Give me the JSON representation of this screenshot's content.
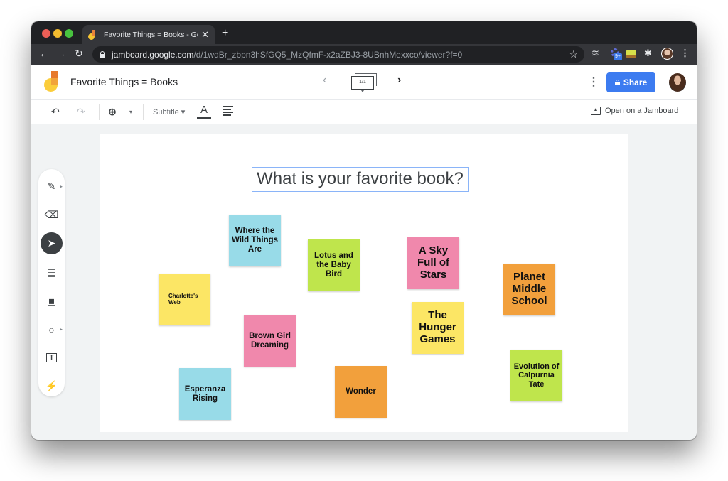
{
  "browser": {
    "tab": {
      "title": "Favorite Things = Books - Google Jamboard",
      "favicon": "jamboard-icon"
    },
    "new_tab": "+",
    "nav": {
      "back": "←",
      "forward": "→",
      "reload": "↻"
    },
    "url": {
      "host": "jamboard.google.com",
      "path": "/d/1wdBr_zbpn3hSfGQ5_MzQfmF-x2aZBJ3-8UBnhMexxco/viewer?f=0"
    },
    "star": "☆",
    "extensions": [
      {
        "name": "layers-extension",
        "glyph": "≋"
      },
      {
        "name": "gear-extension",
        "badge": "9+"
      },
      {
        "name": "note-extension"
      },
      {
        "name": "puzzle-extension",
        "glyph": "✦"
      },
      {
        "name": "profile-avatar"
      }
    ],
    "menu": "⋮"
  },
  "header": {
    "title": "Favorite Things = Books",
    "frame_prev": "‹",
    "frame_indicator": "1/1",
    "frame_next": "›",
    "more": "⋮",
    "share_label": "Share"
  },
  "edit_toolbar": {
    "undo": "↶",
    "redo": "↷",
    "zoom": "⊕",
    "zoom_caret": "▾",
    "text_style": "Subtitle ▾",
    "text_color": "A",
    "open_on_jamboard": "Open on a Jamboard"
  },
  "side_tools": [
    {
      "name": "pen-tool",
      "glyph": "✎",
      "has_menu": true
    },
    {
      "name": "eraser-tool",
      "glyph": "⌫"
    },
    {
      "name": "select-tool",
      "glyph": "➤",
      "active": true
    },
    {
      "name": "sticky-note-tool",
      "glyph": "▤"
    },
    {
      "name": "add-image-tool",
      "glyph": "▣"
    },
    {
      "name": "circle-tool",
      "glyph": "○",
      "has_menu": true
    },
    {
      "name": "text-box-tool",
      "glyph": "T"
    },
    {
      "name": "laser-tool",
      "glyph": "⚡"
    }
  ],
  "canvas": {
    "prompt": "What is your favorite book?",
    "notes": [
      {
        "text": "Where the Wild Things Are",
        "color": "#98dbe8"
      },
      {
        "text": "Lotus and the Baby Bird",
        "color": "#bfe54c"
      },
      {
        "text": "A Sky Full of Stars",
        "color": "#f088ac"
      },
      {
        "text": "Planet Middle School",
        "color": "#f2a03c"
      },
      {
        "text": "Charlotte's Web",
        "color": "#fce665"
      },
      {
        "text": "Brown Girl Dreaming",
        "color": "#f088ac"
      },
      {
        "text": "The Hunger Games",
        "color": "#fce665"
      },
      {
        "text": "Evolution of Calpurnia Tate",
        "color": "#bfe54c"
      },
      {
        "text": "Esperanza Rising",
        "color": "#98dbe8"
      },
      {
        "text": "Wonder",
        "color": "#f2a03c"
      }
    ]
  }
}
